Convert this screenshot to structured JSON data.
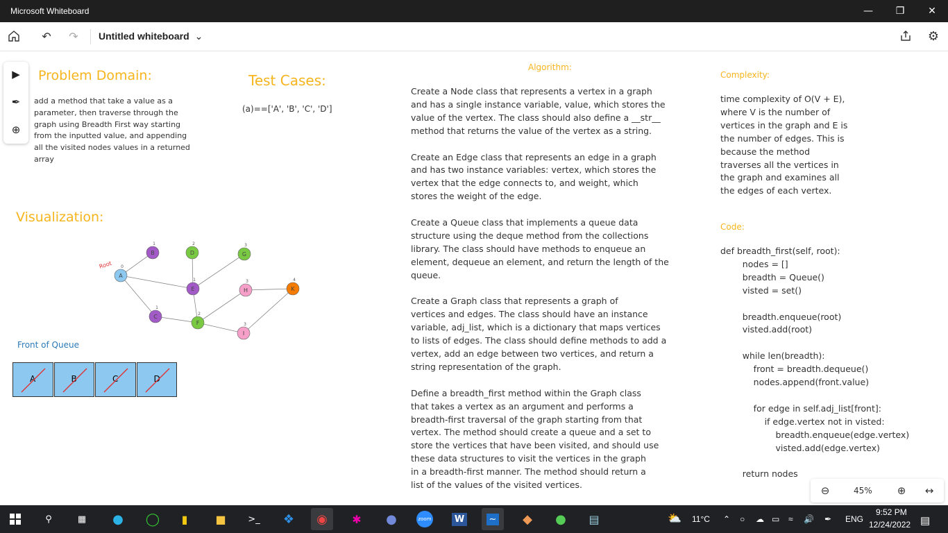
{
  "window": {
    "title": "Microsoft Whiteboard"
  },
  "toolbar": {
    "board_title": "Untitled whiteboard"
  },
  "problem": {
    "heading": "Problem Domain:",
    "lines": [
      "add a method that take a value as a",
      "parameter, then traverse through the",
      "graph using Breadth First way starting",
      "from the inputted value, and appending",
      "all the visited nodes values in a returned",
      "array"
    ]
  },
  "tests": {
    "heading": "Test Cases:",
    "line": "(a)==['A', 'B', 'C', 'D']"
  },
  "algorithm": {
    "heading": "Algorithm:",
    "paragraphs": [
      [
        "Create a Node class that represents a vertex in a graph",
        "and has a single instance variable, value, which stores the",
        "value of the vertex. The class should also define a __str__",
        "method that returns the value of the vertex as a string."
      ],
      [
        "Create an Edge class that represents an edge in a graph",
        "and has two instance variables: vertex, which stores the",
        "vertex that the edge connects to, and weight, which",
        "stores the weight of the edge."
      ],
      [
        "Create a Queue class that implements a queue data",
        "structure using the deque method from the collections",
        "library. The class should have methods to enqueue an",
        "element, dequeue an element, and return the length of the",
        "queue."
      ],
      [
        "Create a Graph class that represents a graph of",
        "vertices and edges. The class should have an instance",
        "variable, adj_list, which is a dictionary that maps vertices",
        "to lists of edges. The class should define methods to add a",
        "vertex, add an edge between two vertices, and return a",
        "string representation of the graph."
      ],
      [
        "Define a breadth_first method within the Graph class",
        "that takes a vertex as an argument and performs a",
        "breadth-first traversal of the graph starting from that",
        "vertex. The method should create a queue and a set to",
        "store the vertices that have been visited, and should use",
        "these data structures to visit the vertices in the graph",
        "in a breadth-first manner. The method should return a",
        "list of the values of the visited vertices."
      ]
    ]
  },
  "complexity": {
    "heading": "Complexity:",
    "lines": [
      "time complexity of O(V + E),",
      "where V is the number of",
      "vertices in the graph and E is",
      "the number of edges. This is",
      "because the method",
      "traverses all the vertices in",
      "the graph and examines all",
      "the edges of each vertex."
    ]
  },
  "code": {
    "heading": "Code:",
    "lines": [
      "def breadth_first(self, root):",
      "        nodes = []",
      "        breadth = Queue()",
      "        visted = set()",
      "",
      "        breadth.enqueue(root)",
      "        visted.add(root)",
      "",
      "        while len(breadth):",
      "            front = breadth.dequeue()",
      "            nodes.append(front.value)",
      "",
      "            for edge in self.adj_list[front]:",
      "                if edge.vertex not in visted:",
      "                    breadth.enqueue(edge.vertex)",
      "                    visted.add(edge.vertex)",
      "",
      "        return nodes"
    ]
  },
  "visualization": {
    "heading": "Visualization:",
    "root_label": "Root",
    "queue_label": "Front of Queue",
    "queue": [
      "A",
      "B",
      "C",
      "D"
    ],
    "nodes": [
      {
        "label": "A",
        "weight": "0",
        "color": "#8cc8f0"
      },
      {
        "label": "B",
        "weight": "1",
        "color": "#a25bc6"
      },
      {
        "label": "D",
        "weight": "2",
        "color": "#7ac943"
      },
      {
        "label": "G",
        "weight": "3",
        "color": "#7ac943"
      },
      {
        "label": "E",
        "weight": "1",
        "color": "#a25bc6"
      },
      {
        "label": "H",
        "weight": "3",
        "color": "#f59fc9"
      },
      {
        "label": "K",
        "weight": "4",
        "color": "#f57c00"
      },
      {
        "label": "C",
        "weight": "1",
        "color": "#a25bc6"
      },
      {
        "label": "F",
        "weight": "2",
        "color": "#7ac943"
      },
      {
        "label": "I",
        "weight": "3",
        "color": "#f59fc9"
      }
    ]
  },
  "zoom": {
    "level": "45%"
  },
  "taskbar": {
    "weather": "11°C",
    "lang": "ENG",
    "time": "9:52 PM",
    "date": "12/24/2022",
    "zoom_app": "zoom"
  }
}
